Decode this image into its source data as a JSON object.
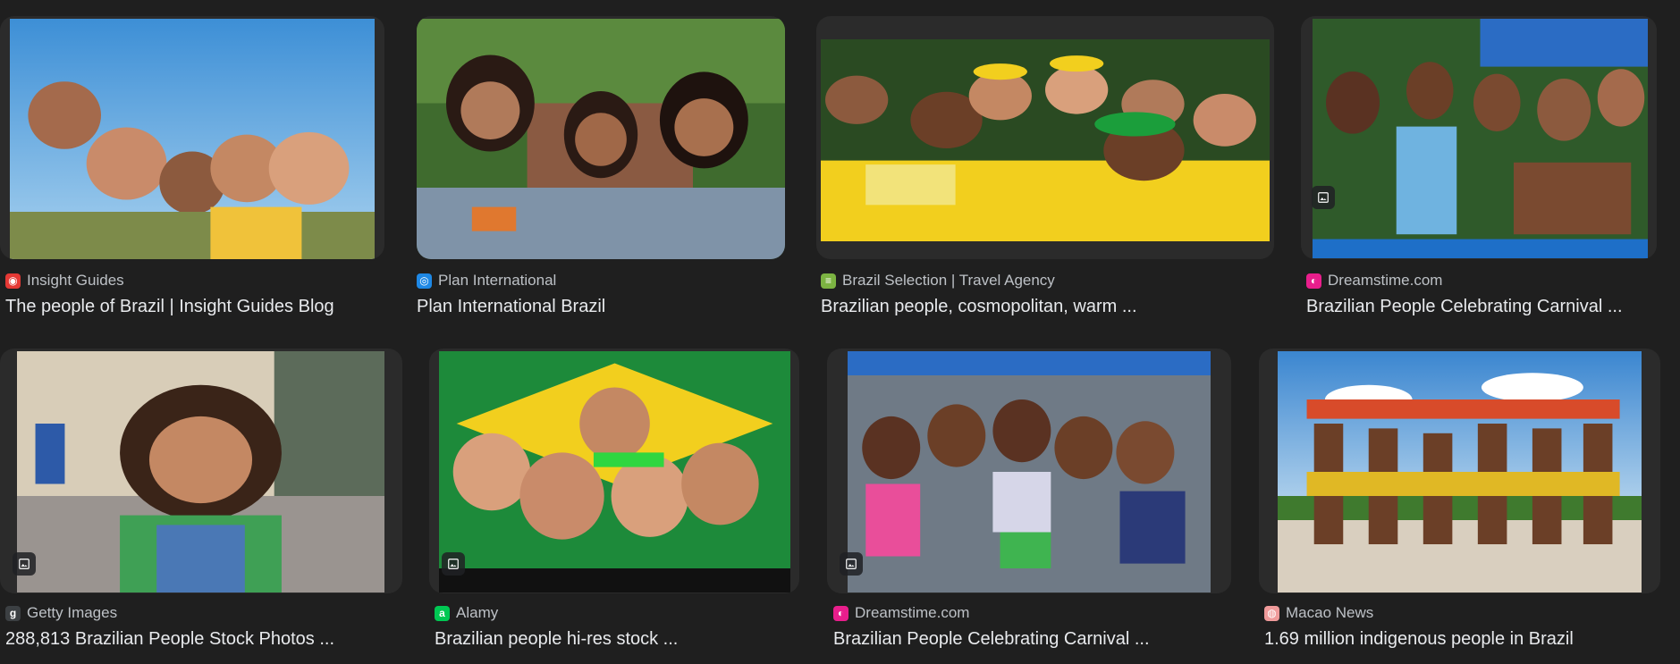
{
  "results": [
    {
      "source": "Insight Guides",
      "title": "The people of Brazil | Insight Guides Blog",
      "favicon_color": "#e53935",
      "favicon_glyph": "◉",
      "icon": "insight-guides-favicon-icon"
    },
    {
      "source": "Plan International",
      "title": "Plan International Brazil",
      "favicon_color": "#1e88e5",
      "favicon_glyph": "◎",
      "icon": "plan-international-favicon-icon"
    },
    {
      "source": "Brazil Selection | Travel Agency",
      "title": "Brazilian people, cosmopolitan, warm ...",
      "favicon_color": "#7cb342",
      "favicon_glyph": "≡",
      "icon": "brazil-selection-favicon-icon"
    },
    {
      "source": "Dreamstime.com",
      "title": "Brazilian People Celebrating Carnival ...",
      "favicon_color": "#e91e8c",
      "favicon_glyph": "◐",
      "icon": "dreamstime-favicon-icon"
    },
    {
      "source": "Getty Images",
      "title": "288,813 Brazilian People Stock Photos ...",
      "favicon_color": "#3c4043",
      "favicon_glyph": "g",
      "icon": "getty-images-favicon-icon"
    },
    {
      "source": "Alamy",
      "title": "Brazilian people hi-res stock ...",
      "favicon_color": "#00c853",
      "favicon_glyph": "a",
      "icon": "alamy-favicon-icon"
    },
    {
      "source": "Dreamstime.com",
      "title": "Brazilian People Celebrating Carnival ...",
      "favicon_color": "#e91e8c",
      "favicon_glyph": "◐",
      "icon": "dreamstime-favicon-icon"
    },
    {
      "source": "Macao News",
      "title": "1.69 million indigenous people in Brazil",
      "favicon_color": "#ef9a9a",
      "favicon_glyph": "◍",
      "icon": "macao-news-favicon-icon"
    }
  ],
  "image_badge_icon": "image-icon",
  "colors": {
    "background": "#1f1f1f",
    "title_text": "#e8eaed",
    "source_text": "#bdc1c6",
    "card_bg": "#2b2b2b"
  }
}
